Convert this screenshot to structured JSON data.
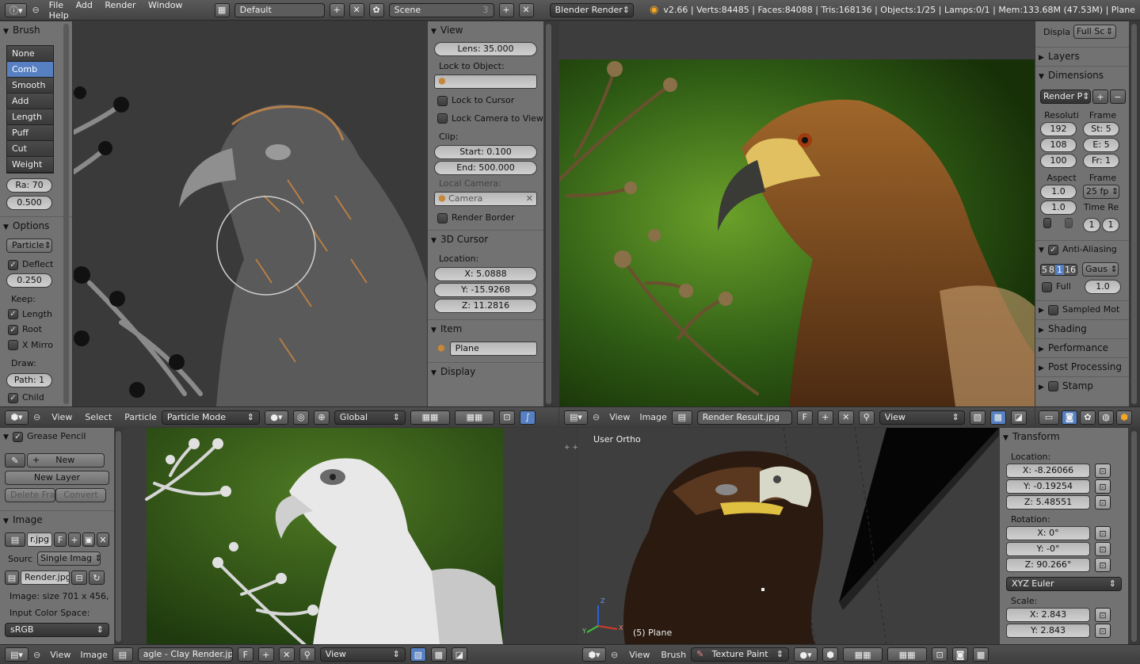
{
  "topbar": {
    "menus": [
      "File",
      "Add",
      "Render",
      "Window",
      "Help"
    ],
    "screen_layout": "Default",
    "scene": "Scene",
    "scene_count": "3",
    "render_engine": "Blender Render",
    "stats": "v2.66 | Verts:84485 | Faces:84088 | Tris:168136 | Objects:1/25 | Lamps:0/1 | Mem:133.68M (47.53M) | Plane"
  },
  "brush_panel": {
    "title": "Brush",
    "brushes": [
      "None",
      "Comb",
      "Smooth",
      "Add",
      "Length",
      "Puff",
      "Cut",
      "Weight"
    ],
    "selected": "Comb",
    "radius": "Ra: 70",
    "strength": "0.500",
    "options_title": "Options",
    "mode": "Particle",
    "deflect_label": "Deflect",
    "deflect_value": "0.250",
    "keep_label": "Keep:",
    "keep_items": [
      "Length",
      "Root",
      "X Mirro"
    ],
    "draw_label": "Draw:",
    "path_value": "Path: 1",
    "child_label": "Child"
  },
  "view_panel": {
    "title": "View",
    "lens": "Lens: 35.000",
    "lock_object_label": "Lock to Object:",
    "lock_cursor": "Lock to Cursor",
    "lock_camera": "Lock Camera to View",
    "clip_label": "Clip:",
    "clip_start": "Start: 0.100",
    "clip_end": "End: 500.000",
    "local_camera_label": "Local Camera:",
    "camera": "Camera",
    "render_border": "Render Border",
    "cursor_title": "3D Cursor",
    "location_label": "Location:",
    "cursor_x": "X: 5.0888",
    "cursor_y": "Y: -15.9268",
    "cursor_z": "Z: 11.2816",
    "item_title": "Item",
    "item_name": "Plane",
    "display_title": "Display"
  },
  "viewport_header_1": {
    "view": "View",
    "select": "Select",
    "particle": "Particle",
    "mode": "Particle Mode",
    "orientation": "Global"
  },
  "image_editor_header_1": {
    "view": "View",
    "image": "Image",
    "image_name": "Render Result.jpg",
    "f": "F",
    "display": "View"
  },
  "render_panel": {
    "display_label": "Displa",
    "display_value": "Full Sc",
    "layers": "Layers",
    "dimensions": "Dimensions",
    "preset": "Render P",
    "resolution_label": "Resoluti",
    "res_x": "192",
    "res_y": "108",
    "res_pct": "100",
    "frame_label": "Frame",
    "start": "St: 5",
    "end": "E: 5",
    "step": "Fr: 1",
    "aspect_label": "Aspect",
    "aspect_x": "1.0",
    "aspect_y": "1.0",
    "frame_rate_label": "Frame",
    "fps": "25 fp",
    "time_remap_label": "Time Re",
    "remap_old": "1",
    "remap_new": "1",
    "anti_aliasing": "Anti-Aliasing",
    "aa_samples": [
      "5",
      "8",
      "1",
      "16"
    ],
    "aa_selected": "1",
    "aa_filter": "Gaus",
    "full_label": "Full",
    "aa_size": "1.0",
    "sampled_motion": "Sampled Mot",
    "shading": "Shading",
    "performance": "Performance",
    "post_processing": "Post Processing",
    "stamp": "Stamp"
  },
  "grease_panel": {
    "title": "Grease Pencil",
    "new": "New",
    "new_layer": "New Layer",
    "delete_frame": "Delete Fram",
    "convert": "Convert",
    "image_title": "Image",
    "image_file": "r.jpg",
    "f": "F",
    "source_label": "Sourc",
    "source_value": "Single Imag",
    "filepath": "Render.jpg",
    "size_info": "Image: size 701 x 456,",
    "input_color_label": "Input Color Space:",
    "input_color_value": "sRGB"
  },
  "image_editor_header_2": {
    "view": "View",
    "image": "Image",
    "image_name": "agle - Clay Render.jpg",
    "f": "F",
    "display": "View"
  },
  "viewport_3d": {
    "label": "User Ortho",
    "object_label": "(5) Plane",
    "axis_z": "Z",
    "axis_x": "X",
    "axis_y": "Y"
  },
  "transform_panel": {
    "title": "Transform",
    "location_label": "Location:",
    "loc_x": "X: -8.26066",
    "loc_y": "Y: -0.19254",
    "loc_z": "Z: 5.48551",
    "rotation_label": "Rotation:",
    "rot_x": "X: 0°",
    "rot_y": "Y: -0°",
    "rot_z": "Z: 90.266°",
    "rotation_mode": "XYZ Euler",
    "scale_label": "Scale:",
    "scale_x": "X: 2.843",
    "scale_y": "Y: 2.843"
  },
  "viewport_header_2": {
    "view": "View",
    "brush": "Brush",
    "mode": "Texture Paint"
  },
  "icons": [
    "info-icon",
    "blender-logo-icon",
    "search-icon",
    "plus-icon",
    "close-icon",
    "cube-icon",
    "camera-icon",
    "checkbox-icon",
    "lock-icon",
    "pin-icon",
    "image-icon"
  ],
  "colors": {
    "selection_blue": "#5680c2",
    "panel_gray": "#727272",
    "header_dark": "#444444",
    "viewport_gray": "#3d3d3d"
  }
}
